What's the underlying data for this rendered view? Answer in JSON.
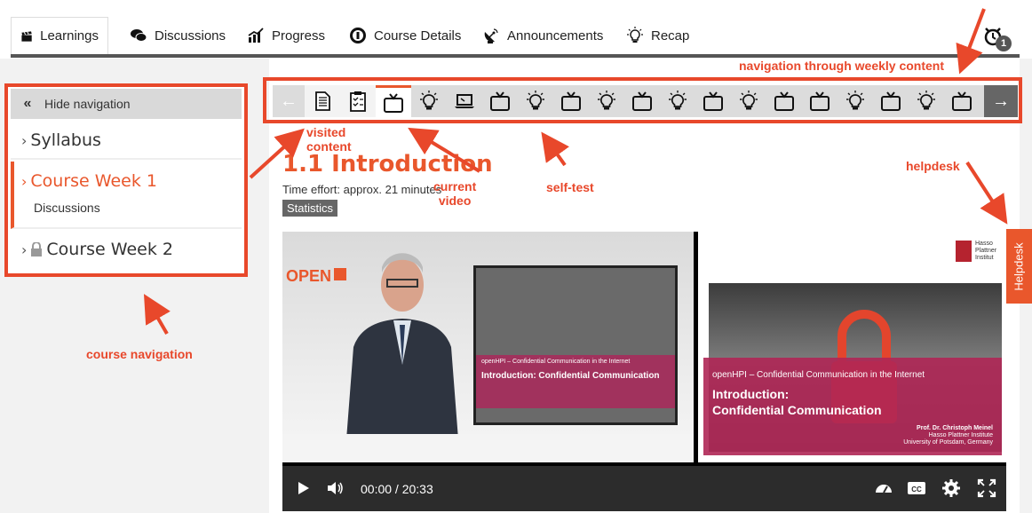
{
  "tabs": [
    {
      "label": "Learnings",
      "icon": "clapperboard-icon",
      "active": true
    },
    {
      "label": "Discussions",
      "icon": "chat-bubbles-icon"
    },
    {
      "label": "Progress",
      "icon": "bar-chart-icon"
    },
    {
      "label": "Course Details",
      "icon": "info-circle-icon"
    },
    {
      "label": "Announcements",
      "icon": "satellite-dish-icon"
    },
    {
      "label": "Recap",
      "icon": "lightbulb-icon"
    }
  ],
  "notifications": {
    "count": "1",
    "icon": "alarm-clock-icon"
  },
  "course_nav": {
    "hide_label": "Hide navigation",
    "syllabus": "Syllabus",
    "week1": "Course Week 1",
    "week1_sub": "Discussions",
    "week2": "Course Week 2"
  },
  "item_nav": {
    "items": [
      "text",
      "quiz",
      "video",
      "selftest",
      "lecture",
      "video",
      "selftest",
      "video",
      "selftest",
      "video",
      "selftest",
      "video",
      "selftest",
      "video",
      "video",
      "selftest",
      "video",
      "selftest",
      "video"
    ],
    "current_index": 2
  },
  "content": {
    "title": "1.1 Introduction",
    "effort": "Time effort: approx. 21 minutes",
    "stats_label": "Statistics"
  },
  "video": {
    "time": "00:00 / 20:33",
    "open_logo": "OPEN",
    "screen_line1": "openHPI – Confidential Communication in the Internet",
    "screen_title": "Introduction: Confidential Communication",
    "slide_line1": "openHPI – Confidential Communication in the Internet",
    "slide_title1": "Introduction:",
    "slide_title2": "Confidential Communication",
    "slide_prof": "Prof. Dr. Christoph Meinel",
    "slide_inst": "Hasso Plattner Institute",
    "slide_uni": "University of Potsdam, Germany",
    "hpi_text": "Hasso Plattner Institut"
  },
  "helpdesk": "Helpdesk",
  "annotations": {
    "weekly": "navigation through weekly content",
    "visited1": "visited",
    "visited2": "content",
    "current1": "current",
    "current2": "video",
    "selftest": "self-test",
    "helpdesk": "helpdesk",
    "course_nav": "course navigation"
  },
  "colors": {
    "accent": "#e9572c",
    "annotation": "#e8482b",
    "bar": "#dcdcdc"
  }
}
